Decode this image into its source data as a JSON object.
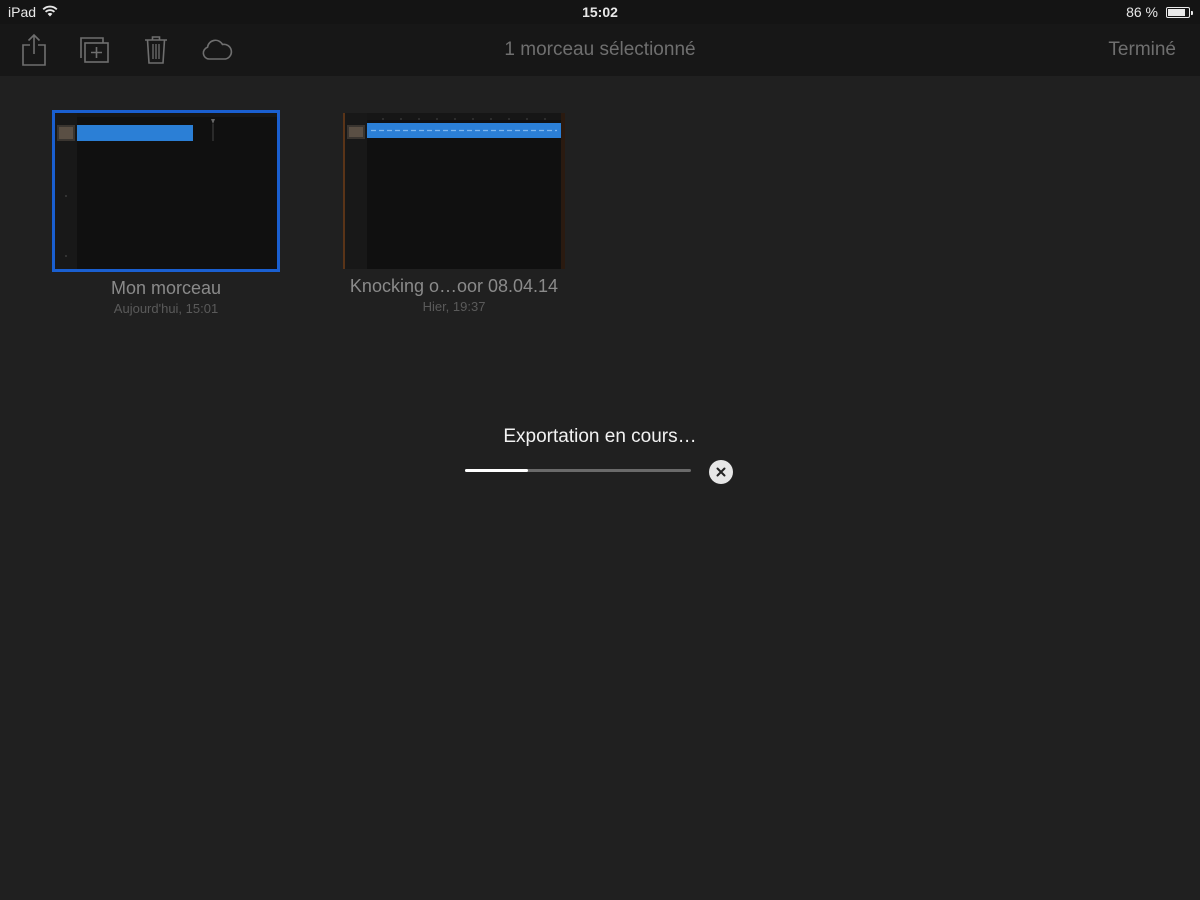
{
  "status_bar": {
    "device": "iPad",
    "time": "15:02",
    "battery": "86 %",
    "battery_level": 0.86,
    "wifi_icon": "wifi-icon"
  },
  "toolbar": {
    "title": "1 morceau sélectionné",
    "done_label": "Terminé",
    "icons": [
      "share-icon",
      "duplicate-icon",
      "trash-icon",
      "cloud-icon"
    ]
  },
  "documents": [
    {
      "name": "Mon morceau",
      "date": "Aujourd'hui, 15:01",
      "selected": true
    },
    {
      "name": "Knocking o…oor 08.04.14",
      "date": "Hier, 19:37",
      "selected": false
    }
  ],
  "export": {
    "label": "Exportation en cours…",
    "progress": 0.28,
    "cancel_icon": "close-icon"
  },
  "colors": {
    "background": "#202020",
    "selection": "#1a5fd0",
    "track_blue": "#2b7fd6",
    "dim_text": "#6f6f6f"
  }
}
